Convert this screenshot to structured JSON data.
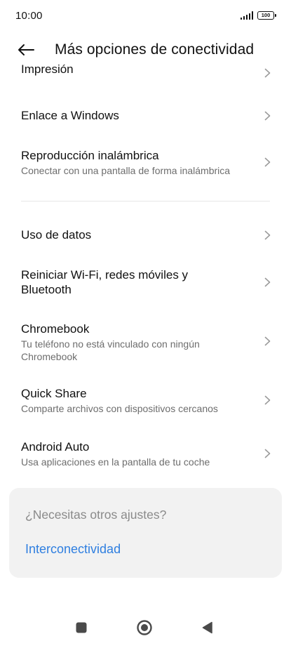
{
  "status": {
    "time": "10:00",
    "battery": "100"
  },
  "header": {
    "title": "Más opciones de conectividad",
    "back_icon": "arrow-left-icon"
  },
  "items": [
    {
      "title": "Impresión",
      "subtitle": ""
    },
    {
      "title": "Enlace a Windows",
      "subtitle": ""
    },
    {
      "title": "Reproducción inalámbrica",
      "subtitle": "Conectar con una pantalla de forma inalámbrica"
    },
    {
      "title": "Uso de datos",
      "subtitle": ""
    },
    {
      "title": "Reiniciar Wi-Fi, redes móviles y Bluetooth",
      "subtitle": ""
    },
    {
      "title": "Chromebook",
      "subtitle": "Tu teléfono no está vinculado con ningún Chromebook"
    },
    {
      "title": "Quick Share",
      "subtitle": "Comparte archivos con dispositivos cercanos"
    },
    {
      "title": "Android Auto",
      "subtitle": "Usa aplicaciones en la pantalla de tu coche"
    }
  ],
  "suggestion": {
    "question": "¿Necesitas otros ajustes?",
    "link": "Interconectividad"
  },
  "nav": {
    "recents_icon": "square-icon",
    "home_icon": "circle-home-icon",
    "back_icon": "triangle-back-icon"
  },
  "colors": {
    "accent": "#2f7fe0",
    "card_bg": "#f2f2f2",
    "subtitle": "#6d6d6d"
  }
}
